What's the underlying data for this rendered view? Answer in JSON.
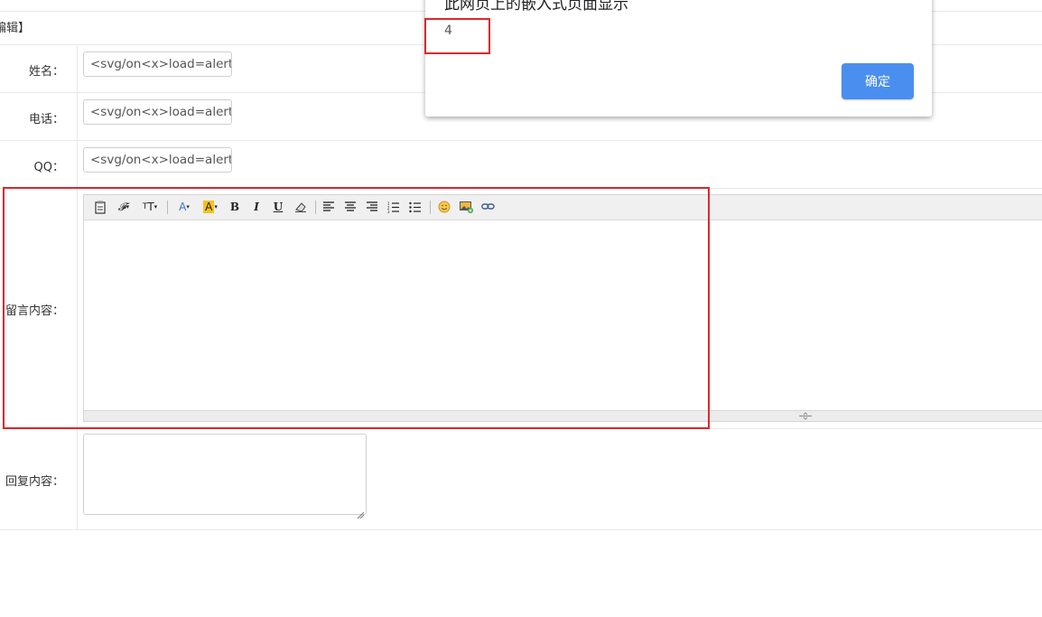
{
  "header": {
    "title": "编辑】"
  },
  "form": {
    "name_label": "姓名：",
    "name_value": "<svg/on<x>load=alert",
    "phone_label": "电话：",
    "phone_value": "<svg/on<x>load=alert",
    "qq_label": "QQ：",
    "qq_value": "<svg/on<x>load=alert",
    "message_label": "留言内容：",
    "reply_label": "回复内容："
  },
  "editor": {
    "toolbar": [
      "paste-icon",
      "font-family-icon",
      "font-size-icon",
      "font-color-icon",
      "highlight-color-icon",
      "bold-icon",
      "italic-icon",
      "underline-icon",
      "remove-format-icon",
      "align-left-icon",
      "align-center-icon",
      "align-right-icon",
      "ordered-list-icon",
      "unordered-list-icon",
      "emoticon-icon",
      "insert-image-icon",
      "insert-link-icon"
    ],
    "bold_glyph": "B",
    "italic_glyph": "I",
    "underline_glyph": "U"
  },
  "dialog": {
    "title": "此网页上的嵌入式页面显示",
    "message": "4",
    "ok_label": "确定"
  },
  "colors": {
    "highlight_box": "#e0262b",
    "ok_button": "#4a8ff0"
  }
}
